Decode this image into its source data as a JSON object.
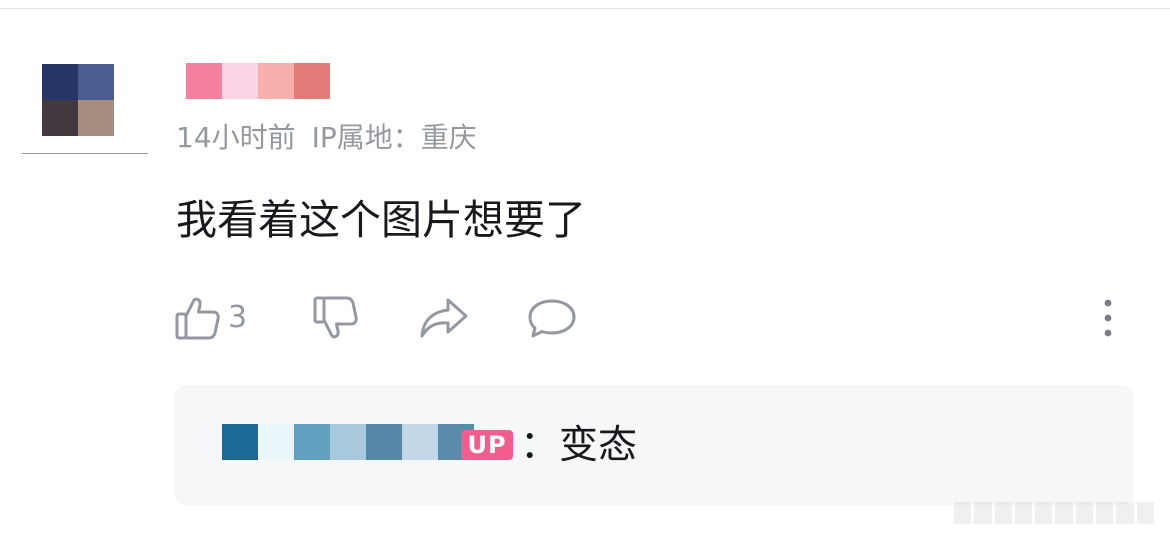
{
  "comment": {
    "time": "14小时前",
    "ip_location": "IP属地：重庆",
    "text": "我看着这个图片想要了",
    "like_count": "3"
  },
  "avatar": {
    "colors": [
      "#263567",
      "#4a5d91",
      "#433840",
      "#a68f81"
    ]
  },
  "username_pixels": [
    "#f5819f",
    "#fad4e4",
    "#f8b0ad",
    "#e27c78"
  ],
  "actions": {
    "like_icon": "thumbs-up-icon",
    "dislike_icon": "thumbs-down-icon",
    "share_icon": "share-icon",
    "reply_icon": "comment-icon",
    "more_icon": "more-vertical-icon"
  },
  "reply": {
    "user_pixels": [
      "#1b6994",
      "#ebf6fa",
      "#62a0c0",
      "#a9c8dc",
      "#5587a7",
      "#c2d8e8",
      "#5b8ba9"
    ],
    "badge": "UP",
    "text": "：变态"
  },
  "colors": {
    "secondary_text": "#9499a0",
    "primary_text": "#18191c",
    "up_badge": "#f25d8e",
    "reply_bg": "#f6f7f8"
  }
}
